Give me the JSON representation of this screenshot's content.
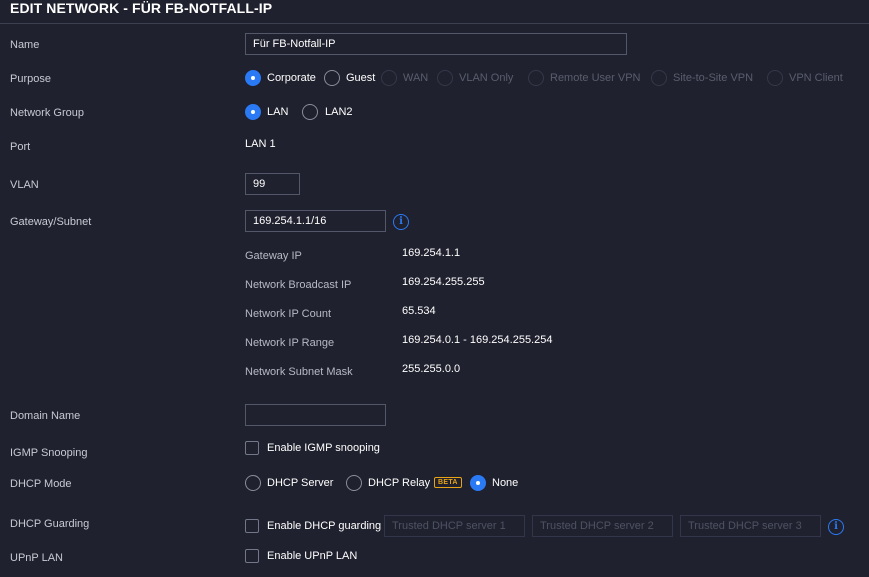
{
  "title": "EDIT NETWORK - FÜR FB-NOTFALL-IP",
  "name": {
    "label": "Name",
    "value": "Für FB-Notfall-IP"
  },
  "purpose": {
    "label": "Purpose",
    "options": [
      "Corporate",
      "Guest",
      "WAN",
      "VLAN Only",
      "Remote User VPN",
      "Site-to-Site VPN",
      "VPN Client"
    ],
    "selected": "Corporate"
  },
  "network_group": {
    "label": "Network Group",
    "options": [
      "LAN",
      "LAN2"
    ],
    "selected": "LAN"
  },
  "port": {
    "label": "Port",
    "value": "LAN 1"
  },
  "vlan": {
    "label": "VLAN",
    "value": "99"
  },
  "gateway_subnet": {
    "label": "Gateway/Subnet",
    "value": "169.254.1.1/16",
    "details": [
      {
        "label": "Gateway IP",
        "value": "169.254.1.1"
      },
      {
        "label": "Network Broadcast IP",
        "value": "169.254.255.255"
      },
      {
        "label": "Network IP Count",
        "value": "65.534"
      },
      {
        "label": "Network IP Range",
        "value": "169.254.0.1 - 169.254.255.254"
      },
      {
        "label": "Network Subnet Mask",
        "value": "255.255.0.0"
      }
    ]
  },
  "domain_name": {
    "label": "Domain Name",
    "value": ""
  },
  "igmp": {
    "label": "IGMP Snooping",
    "checkbox_label": "Enable IGMP snooping",
    "checked": false
  },
  "dhcp_mode": {
    "label": "DHCP Mode",
    "options": [
      "DHCP Server",
      "DHCP Relay",
      "None"
    ],
    "beta": "BETA",
    "selected": "None"
  },
  "dhcp_guarding": {
    "label": "DHCP Guarding",
    "checkbox_label": "Enable DHCP guarding",
    "checked": false,
    "placeholders": [
      "Trusted DHCP server 1",
      "Trusted DHCP server 2",
      "Trusted DHCP server 3"
    ]
  },
  "upnp": {
    "label": "UPnP LAN",
    "checkbox_label": "Enable UPnP LAN",
    "checked": false
  },
  "colors": {
    "background": "#1f212e",
    "accent": "#2b7af5",
    "beta": "#e8a317"
  }
}
